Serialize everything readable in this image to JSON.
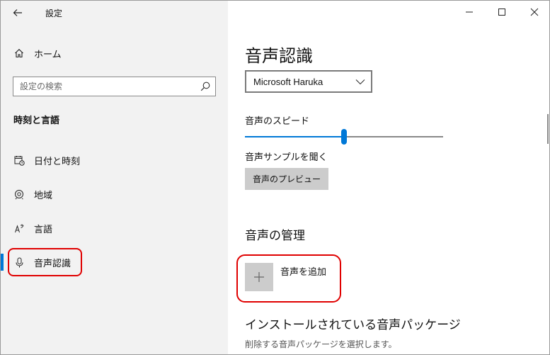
{
  "window": {
    "title": "設定"
  },
  "sidebar": {
    "home_label": "ホーム",
    "search_placeholder": "設定の検索",
    "section_title": "時刻と言語",
    "items": [
      {
        "label": "日付と時刻",
        "icon": "calendar-clock-icon"
      },
      {
        "label": "地域",
        "icon": "globe-icon"
      },
      {
        "label": "言語",
        "icon": "language-icon"
      },
      {
        "label": "音声認識",
        "icon": "microphone-icon",
        "selected": true
      }
    ]
  },
  "content": {
    "page_title": "音声認識",
    "voice_select_value": "Microsoft Haruka",
    "speed_label": "音声のスピード",
    "speed_value": 0.5,
    "sample_label": "音声サンプルを聞く",
    "preview_button": "音声のプレビュー",
    "manage_heading": "音声の管理",
    "add_voice_label": "音声を追加",
    "installed_heading": "インストールされている音声パッケージ",
    "installed_desc": "削除する音声パッケージを選択します。"
  },
  "colors": {
    "accent": "#0078d7",
    "highlight": "#e00000",
    "sidebar_bg": "#f2f2f2"
  }
}
